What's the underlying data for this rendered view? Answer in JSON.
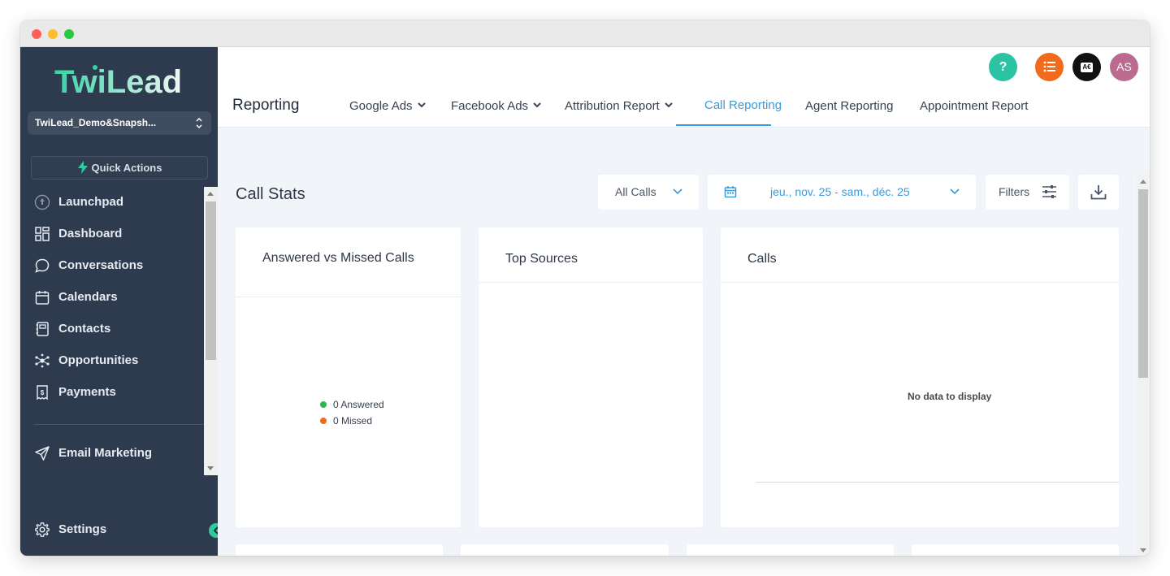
{
  "brand": {
    "logo_text": "TwiLead",
    "accent": "#2ecc9c"
  },
  "sidebar": {
    "location": "TwiLead_Demo&Snapsh...",
    "quick_actions": "Quick Actions",
    "items": [
      {
        "label": "Launchpad",
        "icon": "rocket-icon"
      },
      {
        "label": "Dashboard",
        "icon": "grid-icon"
      },
      {
        "label": "Conversations",
        "icon": "chat-icon"
      },
      {
        "label": "Calendars",
        "icon": "calendar-icon"
      },
      {
        "label": "Contacts",
        "icon": "contacts-icon"
      },
      {
        "label": "Opportunities",
        "icon": "opportunities-icon"
      },
      {
        "label": "Payments",
        "icon": "payments-icon"
      },
      {
        "label": "Email Marketing",
        "icon": "send-icon"
      }
    ],
    "settings": "Settings"
  },
  "header": {
    "help_glyph": "?",
    "az_glyph": "A€",
    "avatar_initials": "AS",
    "page_title": "Reporting",
    "tabs": [
      {
        "label": "Google Ads",
        "dropdown": true
      },
      {
        "label": "Facebook Ads",
        "dropdown": true
      },
      {
        "label": "Attribution Report",
        "dropdown": true
      },
      {
        "label": "Call Reporting",
        "dropdown": false,
        "active": true
      },
      {
        "label": "Agent Reporting",
        "dropdown": false
      },
      {
        "label": "Appointment Report",
        "dropdown": false
      }
    ]
  },
  "toolbar": {
    "section_title": "Call Stats",
    "calls_filter": "All Calls",
    "date_range": "jeu., nov. 25 - sam., déc. 25",
    "filters_label": "Filters"
  },
  "cards": {
    "answered_vs_missed": {
      "title": "Answered vs Missed Calls",
      "legend": [
        {
          "label": "0 Answered",
          "color": "#2db84b"
        },
        {
          "label": "0 Missed",
          "color": "#f26b1d"
        }
      ]
    },
    "top_sources": {
      "title": "Top Sources"
    },
    "calls": {
      "title": "Calls",
      "empty_message": "No data to display"
    }
  },
  "colors": {
    "sidebar_bg": "#2e3a4e",
    "active_tab": "#3b9bd9",
    "content_bg": "#f1f5f9"
  }
}
